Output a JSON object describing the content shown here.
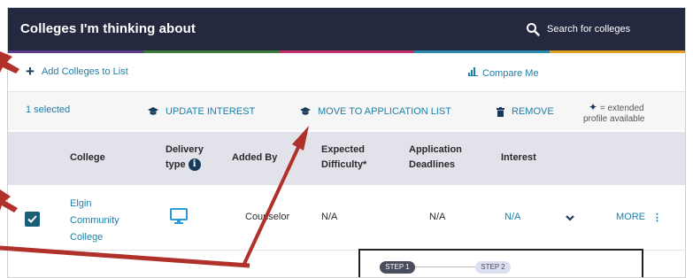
{
  "header": {
    "title": "Colleges I'm thinking about",
    "search_label": "Search for colleges"
  },
  "toolbar": {
    "add_label": "Add Colleges to List",
    "compare_label": "Compare Me"
  },
  "actions": {
    "selected_text": "1 selected",
    "update_interest": "UPDATE INTEREST",
    "move_to_application": "MOVE TO APPLICATION LIST",
    "remove": "REMOVE",
    "legend_line1": "= extended",
    "legend_line2": "profile available"
  },
  "table": {
    "headers": {
      "college": "College",
      "delivery_line1": "Delivery",
      "delivery_line2": "type",
      "added_by": "Added By",
      "difficulty_line1": "Expected",
      "difficulty_line2": "Difficulty*",
      "deadlines_line1": "Application",
      "deadlines_line2": "Deadlines",
      "interest": "Interest"
    },
    "rows": [
      {
        "college_line1": "Elgin",
        "college_line2": "Community",
        "college_line3": "College",
        "added_by": "Counselor",
        "difficulty": "N/A",
        "deadlines": "N/A",
        "interest": "N/A",
        "more": "MORE",
        "checked": true
      }
    ]
  },
  "steps": {
    "step1": "STEP 1",
    "step2": "STEP 2"
  },
  "colors": {
    "header_bg": "#252940",
    "accent_bar": [
      "#5a3a8c",
      "#3a7a3a",
      "#c0306a",
      "#2a8ab0",
      "#e0a020"
    ],
    "link": "#1a7fa8",
    "annotation_arrow": "#b0302a"
  },
  "icons": [
    "search-icon",
    "plus-icon",
    "bar-chart-icon",
    "graduation-cap-icon",
    "trash-icon",
    "star-icon",
    "info-icon",
    "check-icon",
    "monitor-icon",
    "chevron-down-icon",
    "kebab-icon"
  ]
}
